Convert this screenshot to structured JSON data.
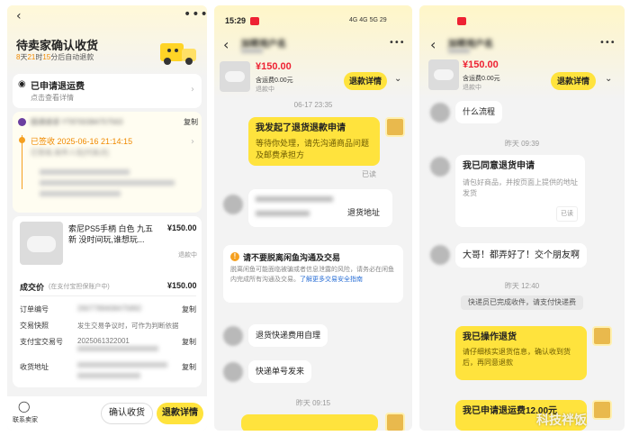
{
  "p1": {
    "header_title": "待卖家确认收货",
    "countdown": {
      "d": "8",
      "dl": "天",
      "h": "21",
      "hl": "时",
      "m": "15",
      "rest": "分后自动退款"
    },
    "refund_shipping_title": "已申请退运费",
    "refund_shipping_sub": "点击查看详情",
    "courier": "圆通速递 YT8700384757563",
    "copy": "复制",
    "track_status": "已签收 2025-06-16 21:14:15",
    "track_detail": "已签收,收件人在[代收点]",
    "product_name": "索尼PS5手柄 白色 九五新 没时间玩,谁想玩...",
    "product_price": "¥150.00",
    "refund_status": "退款中",
    "deal_price_label": "成交价",
    "deal_price_note": "(在支付宝担保账户中)",
    "deal_price": "¥150.00",
    "rows": [
      {
        "label": "订单编号",
        "value": "2607789408475892",
        "action": "复制"
      },
      {
        "label": "交易快照",
        "value": "发生交易争议时，可作为判断依据",
        "action": ""
      },
      {
        "label": "支付宝交易号",
        "value": "2025061322001",
        "action": "复制"
      },
      {
        "label": "收货地址",
        "value": "",
        "action": "复制"
      }
    ],
    "contact_label": "联系卖家",
    "confirm_btn": "确认收货",
    "refund_btn": "退款详情"
  },
  "p2": {
    "time": "15:29",
    "status_icons": "4G 4G 5G 29",
    "name": "加密用户名",
    "product_price": "¥150.00",
    "shipping": "含运费0.00元",
    "refund_status": "退款中",
    "refund_btn": "退款详情",
    "ts1": "06-17 23:35",
    "msg1_title": "我发起了退货退款申请",
    "msg1_body": "等待你处理，请先沟通商品问题及邮费承担方",
    "read1": "已读",
    "addr_suffix": "退货地址",
    "warn_title": "请不要脱离闲鱼沟通及交易",
    "warn_body": "脱离闲鱼可能面临被骗或者信息泄露的风险，请务必在闲鱼内完成所有沟通及交易。",
    "warn_link": "了解更多交易安全指南",
    "msg_a": "退货快递费用自理",
    "msg_b": "快递单号发来",
    "ts2": "昨天 09:15"
  },
  "p3": {
    "name": "加密用户名",
    "product_price": "¥150.00",
    "shipping": "含运费0.00元",
    "refund_status": "退款中",
    "refund_btn": "退款详情",
    "msg1": "什么流程",
    "ts1": "昨天 09:39",
    "card_title": "我已同意退货申请",
    "card_body": "请包好商品，并按页面上提供的地址发货",
    "card_read": "已读",
    "msg2": "大哥！都弄好了！交个朋友啊",
    "ts2": "昨天 12:40",
    "sys_note": "快递员已完成收件，请支付快递费",
    "op_title": "我已操作退货",
    "op_body": "请仔细核实退货信息，确认收到货后，再同意退款",
    "last_title": "我已申请退运费12.00元"
  },
  "watermark": "科技袢饭"
}
